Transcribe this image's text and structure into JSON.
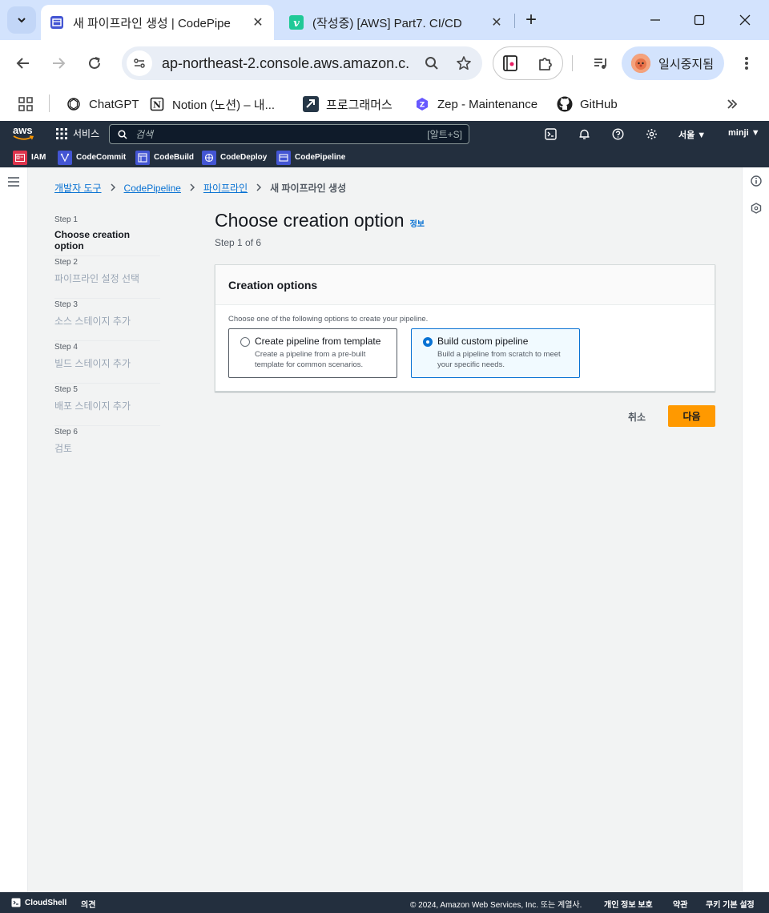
{
  "browser": {
    "tabs": [
      {
        "title": "새 파이프라인 생성 | CodePipe",
        "active": true
      },
      {
        "title": "(작성중) [AWS] Part7. CI/CD",
        "active": false
      }
    ],
    "url": "ap-northeast-2.console.aws.amazon.c...",
    "profile_label": "일시중지됨",
    "bookmarks": [
      "ChatGPT",
      "Notion (노션) – 내...",
      "프로그래머스",
      "Zep - Maintenance",
      "GitHub"
    ]
  },
  "aws_header": {
    "logo": "aws",
    "services_label": "서비스",
    "search_placeholder": "검색",
    "search_shortcut": "[알트+S]",
    "region": "서울 ▼",
    "user": "minji ▼",
    "favorites": [
      "IAM",
      "CodeCommit",
      "CodeBuild",
      "CodeDeploy",
      "CodePipeline"
    ]
  },
  "breadcrumb": {
    "items": [
      "개발자 도구",
      "CodePipeline",
      "파이프라인"
    ],
    "current": "새 파이프라인 생성"
  },
  "steps": [
    {
      "num": "Step 1",
      "title": "Choose creation option",
      "current": true
    },
    {
      "num": "Step 2",
      "title": "파이프라인 설정 선택",
      "current": false
    },
    {
      "num": "Step 3",
      "title": "소스 스테이지 추가",
      "current": false
    },
    {
      "num": "Step 4",
      "title": "빌드 스테이지 추가",
      "current": false
    },
    {
      "num": "Step 5",
      "title": "배포 스테이지 추가",
      "current": false
    },
    {
      "num": "Step 6",
      "title": "검토",
      "current": false
    }
  ],
  "page": {
    "title": "Choose creation option",
    "info_link": "정보",
    "step_indicator": "Step 1 of 6"
  },
  "creation_options": {
    "header": "Creation options",
    "description": "Choose one of the following options to create your pipeline.",
    "options": [
      {
        "title": "Create pipeline from template",
        "description": "Create a pipeline from a pre-built template for common scenarios.",
        "selected": false
      },
      {
        "title": "Build custom pipeline",
        "description": "Build a pipeline from scratch to meet your specific needs.",
        "selected": true
      }
    ]
  },
  "actions": {
    "cancel": "취소",
    "next": "다음"
  },
  "footer": {
    "cloudshell": "CloudShell",
    "feedback": "의견",
    "copyright": "© 2024, Amazon Web Services, Inc. 또는 계열사.",
    "privacy": "개인 정보 보호",
    "terms": "약관",
    "cookies": "쿠키 기본 설정"
  },
  "colors": {
    "aws_nav": "#232f3e",
    "accent_orange": "#ff9900",
    "link_blue": "#0972d3",
    "browser_frame": "#d3e3fd"
  }
}
